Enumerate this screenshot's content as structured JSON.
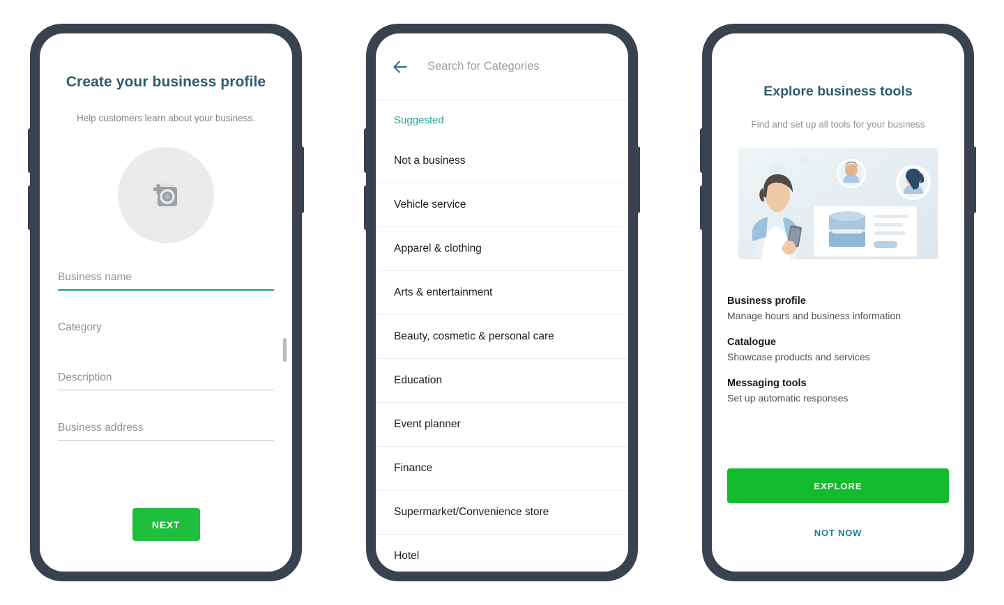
{
  "theme": {
    "frame_color": "#3a4250",
    "screen_bg": "#ffffff",
    "title_color": "#2d5c6e",
    "accent_green": "#1fbf3d",
    "accent_teal": "#23a38f",
    "link_color": "#1b7f9a",
    "muted_text": "#8b9194"
  },
  "screen1": {
    "title": "Create your business profile",
    "subtitle": "Help customers learn about your business.",
    "avatar_icon": "add-photo-icon",
    "fields": [
      {
        "label": "Business name",
        "value": "",
        "state": "focused"
      },
      {
        "label": "Category",
        "value": "",
        "state": "hidden-underline"
      },
      {
        "label": "Description",
        "value": "",
        "state": "default"
      },
      {
        "label": "Business address",
        "value": "",
        "state": "default"
      }
    ],
    "next_label": "NEXT"
  },
  "screen2": {
    "back_icon": "back-arrow-icon",
    "search_placeholder": "Search for Categories",
    "search_value": "",
    "section_header": "Suggested",
    "categories": [
      "Not a business",
      "Vehicle service",
      "Apparel & clothing",
      "Arts & entertainment",
      "Beauty, cosmetic & personal care",
      "Education",
      "Event planner",
      "Finance",
      "Supermarket/Convenience store",
      "Hotel"
    ]
  },
  "screen3": {
    "title": "Explore business tools",
    "subtitle": "Find and set up all tools for your business",
    "illustration_alt": "business-owner-with-phone-illustration",
    "features": [
      {
        "title": "Business profile",
        "desc": "Manage hours and business information"
      },
      {
        "title": "Catalogue",
        "desc": "Showcase products and services"
      },
      {
        "title": "Messaging tools",
        "desc": "Set up automatic responses"
      }
    ],
    "explore_label": "EXPLORE",
    "not_now_label": "NOT NOW"
  }
}
